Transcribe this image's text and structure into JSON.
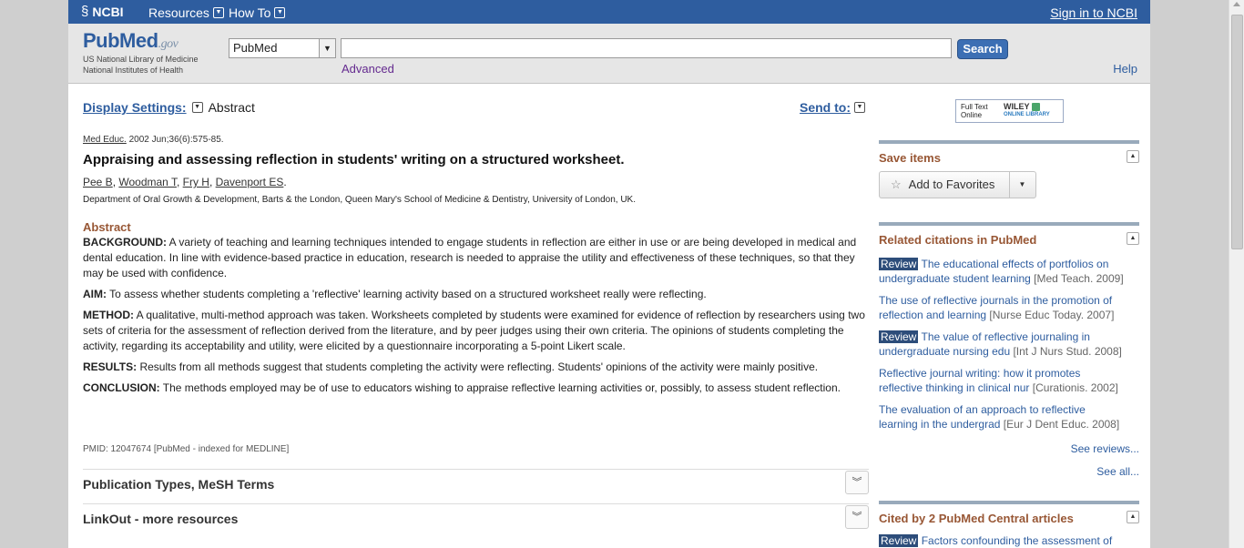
{
  "ncbi_bar": {
    "logo": "NCBI",
    "menu": [
      {
        "label": "Resources"
      },
      {
        "label": "How To"
      }
    ],
    "signin": "Sign in to NCBI"
  },
  "search": {
    "logo_main": "PubMed",
    "logo_gov": ".gov",
    "logo_sub1": "US National Library of Medicine",
    "logo_sub2": "National Institutes of Health",
    "database": "PubMed",
    "query": "",
    "button": "Search",
    "advanced": "Advanced",
    "help": "Help"
  },
  "display": {
    "settings_label": "Display Settings:",
    "settings_value": "Abstract",
    "send_to": "Send to:"
  },
  "article": {
    "journal": "Med Educ.",
    "citation_rest": " 2002 Jun;36(6):575-85.",
    "title": "Appraising and assessing reflection in students' writing on a structured worksheet.",
    "authors": [
      "Pee B",
      "Woodman T",
      "Fry H",
      "Davenport ES"
    ],
    "affiliation": "Department of Oral Growth & Development, Barts & the London, Queen Mary's School of Medicine & Dentistry, University of London, UK.",
    "abstract_heading": "Abstract",
    "sections": [
      {
        "label": "BACKGROUND:",
        "text": "A variety of teaching and learning techniques intended to engage students in reflection are either in use or are being developed in medical and dental education. In line with evidence-based practice in education, research is needed to appraise the utility and effectiveness of these techniques, so that they may be used with confidence."
      },
      {
        "label": "AIM:",
        "text": "To assess whether students completing a 'reflective' learning activity based on a structured worksheet really were reflecting."
      },
      {
        "label": "METHOD:",
        "text": "A qualitative, multi-method approach was taken. Worksheets completed by students were examined for evidence of reflection by researchers using two sets of criteria for the assessment of reflection derived from the literature, and by peer judges using their own criteria. The opinions of students completing the activity, regarding its acceptability and utility, were elicited by a questionnaire incorporating a 5-point Likert scale."
      },
      {
        "label": "RESULTS:",
        "text": "Results from all methods suggest that students completing the activity were reflecting. Students' opinions of the activity were mainly positive."
      },
      {
        "label": "CONCLUSION:",
        "text": "The methods employed may be of use to educators wishing to appraise reflective learning activities or, possibly, to assess student reflection."
      }
    ],
    "pmid": "PMID: 12047674 [PubMed - indexed for MEDLINE]",
    "pub_types": "Publication Types, MeSH Terms",
    "linkout": "LinkOut - more resources"
  },
  "sidebar": {
    "fulltext": {
      "line1": "Full Text",
      "line2": "Online",
      "brand": "WILEY",
      "brand_sub": "ONLINE LIBRARY"
    },
    "save": {
      "title": "Save items",
      "add_favorites": "Add to Favorites"
    },
    "related": {
      "title": "Related citations in PubMed",
      "items": [
        {
          "review": true,
          "badge": "Review",
          "line1": "The educational effects of portfolios on",
          "line2": "undergraduate student learning",
          "source": "[Med Teach. 2009]"
        },
        {
          "review": false,
          "badge": "",
          "line1": "The use of reflective journals in the promotion of",
          "line2": "reflection and learning",
          "source": "[Nurse Educ Today. 2007]"
        },
        {
          "review": true,
          "badge": "Review",
          "line1": "The value of reflective journaling in",
          "line2": "undergraduate nursing edu",
          "source": "[Int J Nurs Stud. 2008]"
        },
        {
          "review": false,
          "badge": "",
          "line1": "Reflective journal writing: how it promotes",
          "line2": "reflective thinking in clinical nur",
          "source": "[Curationis. 2002]"
        },
        {
          "review": false,
          "badge": "",
          "line1": "The evaluation of an approach to reflective",
          "line2": "learning in the undergrad",
          "source": "[Eur J Dent Educ. 2008]"
        }
      ],
      "see_reviews": "See reviews...",
      "see_all": "See all..."
    },
    "cited": {
      "title": "Cited by 2 PubMed Central articles",
      "first_badge": "Review",
      "first_text": "Factors confounding the assessment of"
    }
  }
}
